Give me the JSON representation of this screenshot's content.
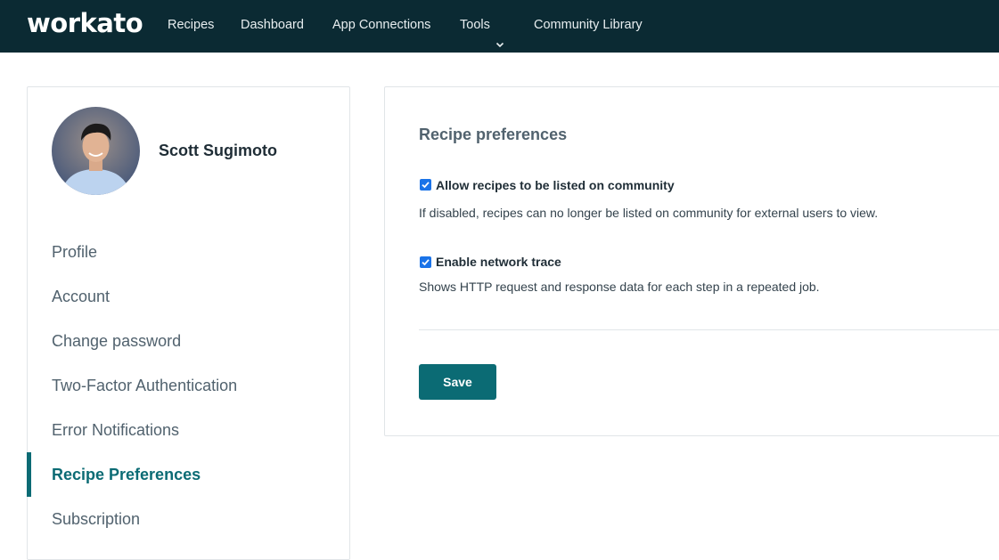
{
  "brand": {
    "logo_text": "workato"
  },
  "nav": {
    "items": [
      {
        "label": "Recipes"
      },
      {
        "label": "Dashboard"
      },
      {
        "label": "App Connections"
      },
      {
        "label": "Tools",
        "icon": "chevron-down-icon"
      },
      {
        "label": "Community Library"
      }
    ]
  },
  "profile": {
    "name": "Scott Sugimoto"
  },
  "sidebar": {
    "items": [
      {
        "label": "Profile"
      },
      {
        "label": "Account"
      },
      {
        "label": "Change password"
      },
      {
        "label": "Two-Factor Authentication"
      },
      {
        "label": "Error Notifications"
      },
      {
        "label": "Recipe Preferences",
        "active": true
      },
      {
        "label": "Subscription"
      }
    ]
  },
  "main": {
    "section_title": "Recipe preferences",
    "options": [
      {
        "label": "Allow recipes to be listed on community",
        "checked": true,
        "help": "If disabled, recipes can no longer be listed on community for external users to view."
      },
      {
        "label": "Enable network trace",
        "checked": true,
        "help": "Shows HTTP request and response data for each step in a repeated job."
      }
    ],
    "save_label": "Save"
  },
  "colors": {
    "topbar": "#0b2a33",
    "accent": "#0b6b74",
    "checkbox": "#1a73e8"
  }
}
